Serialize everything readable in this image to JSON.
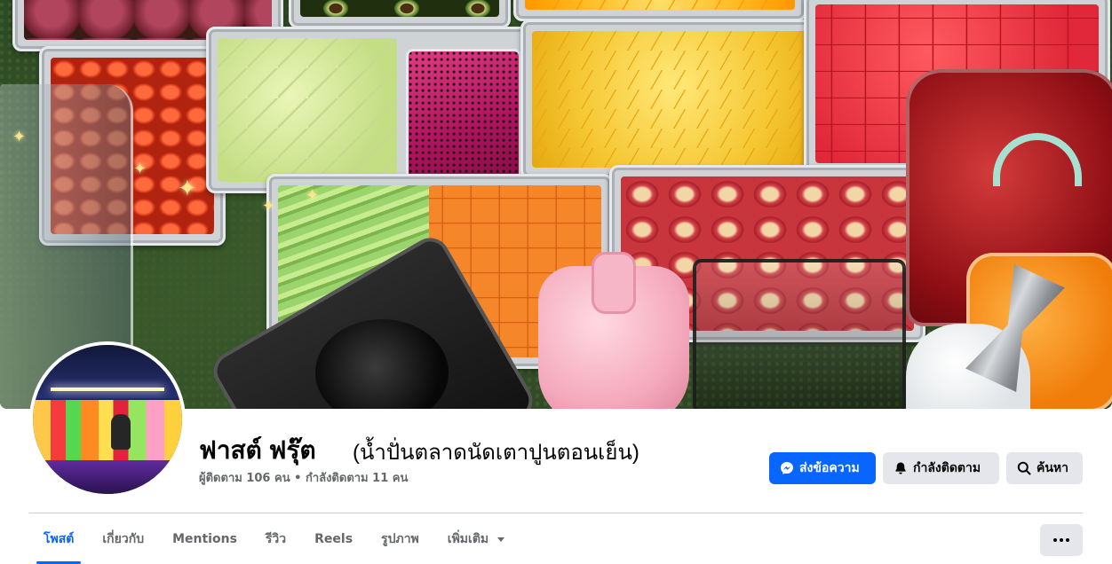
{
  "page": {
    "name": "ฟาสต์ ฟรุ๊ต",
    "subtitle": "(น้ำปั่นตลาดนัดเตาปูนตอนเย็น)",
    "stats": "ผู้ติดตาม 106 คน • กำลังติดตาม 11 คน"
  },
  "actions": {
    "message_label": "ส่งข้อความ",
    "following_label": "กำลังติดตาม",
    "search_label": "ค้นหา"
  },
  "tabs": [
    {
      "label": "โพสต์",
      "active": true
    },
    {
      "label": "เกี่ยวกับ",
      "active": false
    },
    {
      "label": "Mentions",
      "active": false
    },
    {
      "label": "รีวิว",
      "active": false
    },
    {
      "label": "Reels",
      "active": false
    },
    {
      "label": "รูปภาพ",
      "active": false
    },
    {
      "label": "เพิ่มเติม",
      "active": false
    }
  ],
  "icons": {
    "message": "messenger-icon",
    "following": "bell-icon",
    "search": "search-icon",
    "more": "more-horizontal-icon",
    "dropdown": "caret-down-icon"
  },
  "colors": {
    "accent": "#0866ff",
    "secondary_button": "#e4e6eb",
    "muted_text": "#65676b"
  }
}
